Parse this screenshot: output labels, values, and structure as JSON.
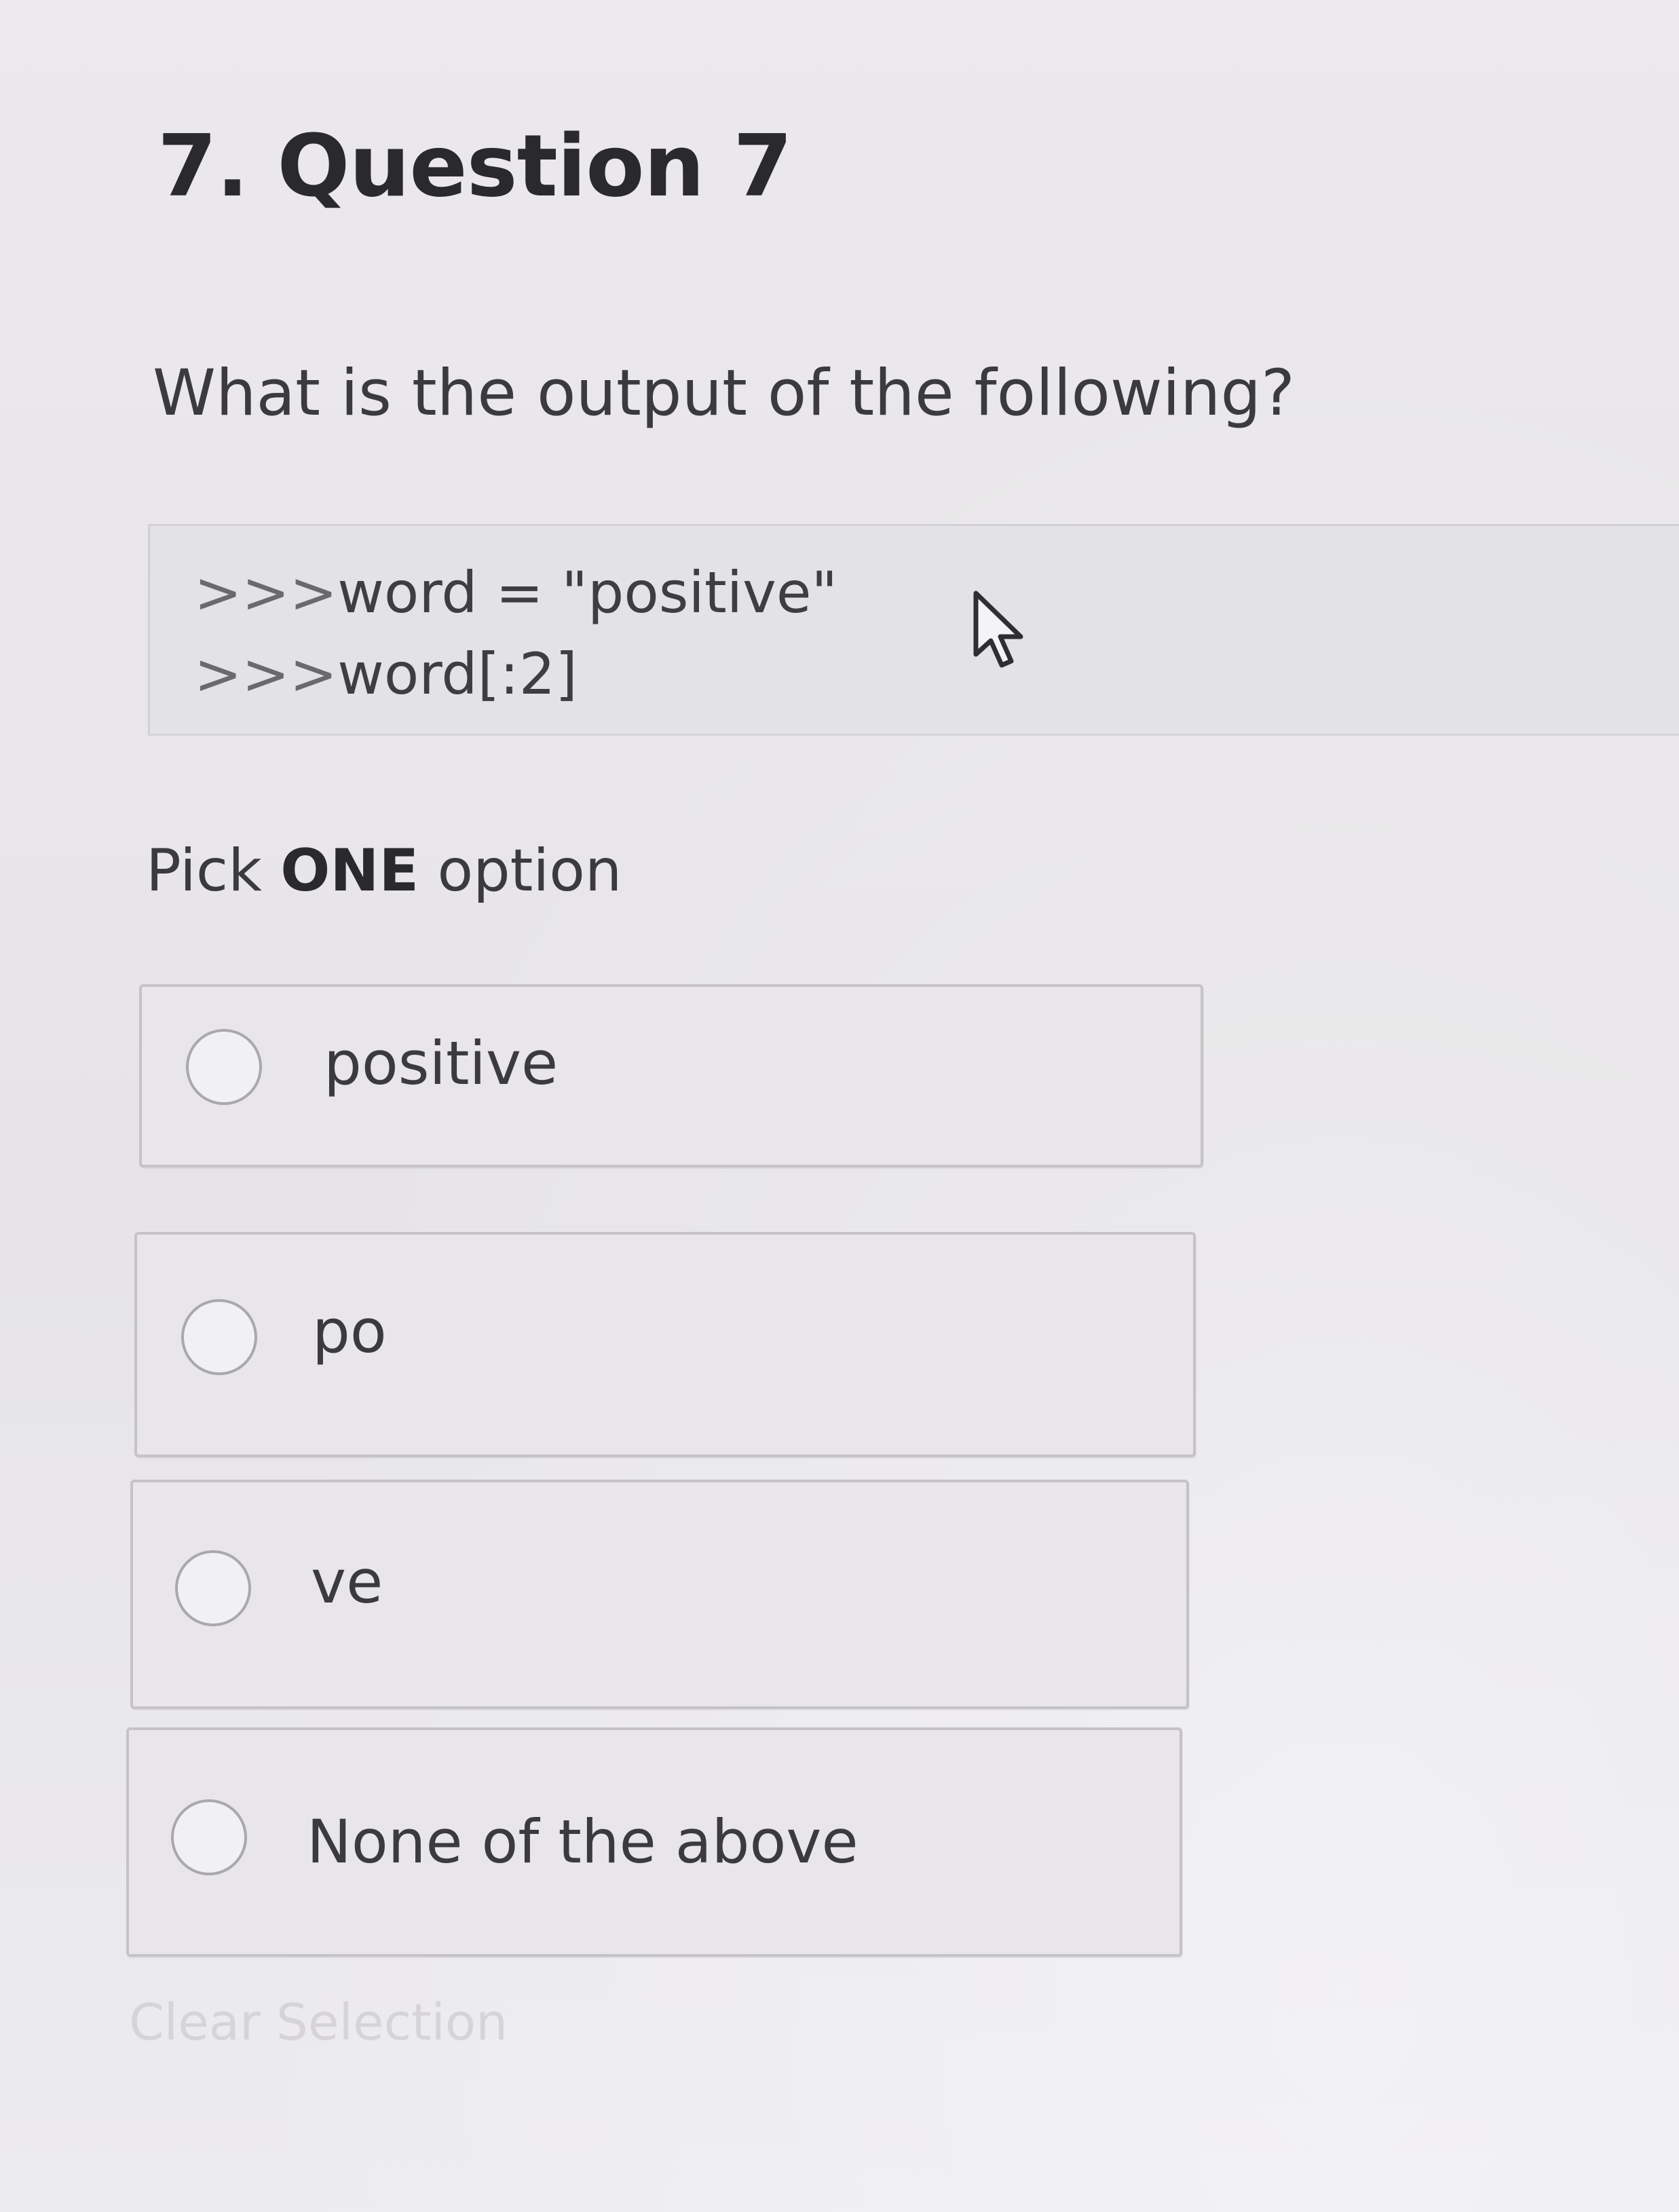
{
  "question": {
    "title": "7. Question 7",
    "prompt": "What is the output of the following?",
    "code": {
      "prompt_symbol": ">>>",
      "lines": [
        "word = \"positive\"",
        "word[:2]"
      ]
    }
  },
  "instruction": {
    "prefix": "Pick ",
    "emphasis": "ONE",
    "suffix": " option"
  },
  "options": [
    {
      "label": "positive",
      "selected": false
    },
    {
      "label": "po",
      "selected": false
    },
    {
      "label": "ve",
      "selected": false
    },
    {
      "label": "None of the above",
      "selected": false
    }
  ],
  "clear_selection_label": "Clear Selection",
  "icons": {
    "cursor": "mouse-pointer-icon",
    "radio": "radio-button-icon"
  }
}
